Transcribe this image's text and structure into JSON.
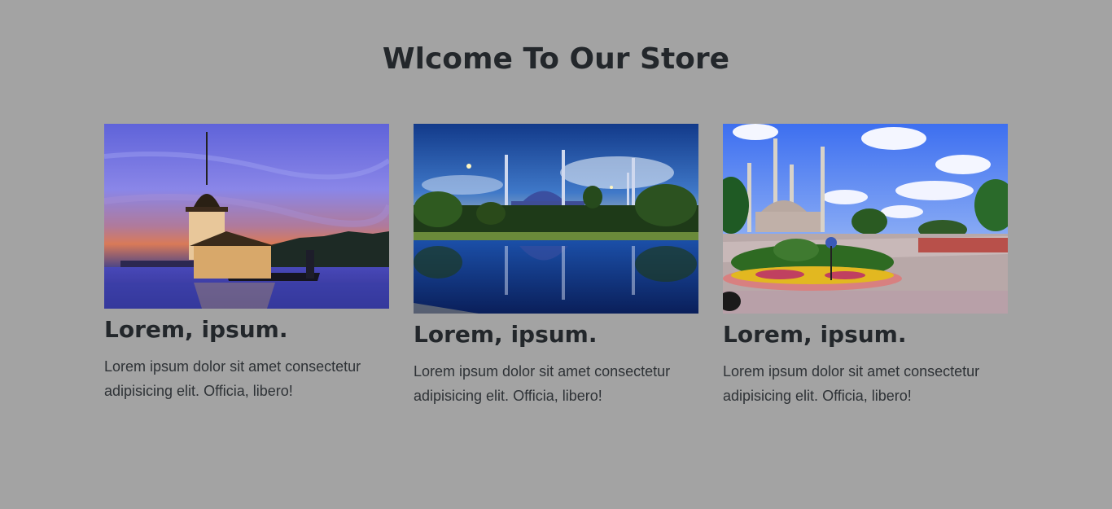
{
  "page": {
    "title": "Wlcome To Our Store",
    "background": "#a3a3a3"
  },
  "cards": [
    {
      "title": "Lorem, ipsum.",
      "text": "Lorem ipsum dolor sit amet consectetur adipisicing elit. Officia, libero!",
      "image": "maiden-tower-at-dusk"
    },
    {
      "title": "Lorem, ipsum.",
      "text": "Lorem ipsum dolor sit amet consectetur adipisicing elit. Officia, libero!",
      "image": "blue-mosque-night-reflection"
    },
    {
      "title": "Lorem, ipsum.",
      "text": "Lorem ipsum dolor sit amet consectetur adipisicing elit. Officia, libero!",
      "image": "mosque-with-garden-daytime"
    }
  ]
}
